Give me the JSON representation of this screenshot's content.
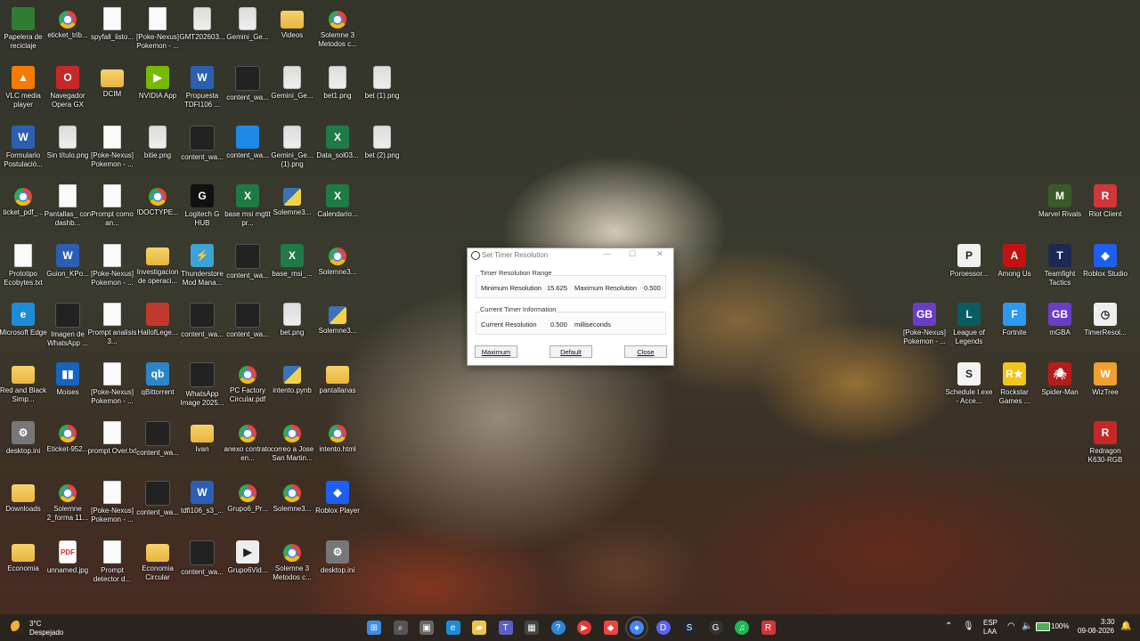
{
  "desktop": {
    "icons": [
      {
        "label": "Papelera de reciclaje",
        "type": "bin"
      },
      {
        "label": "eticket_trib...",
        "type": "chrome"
      },
      {
        "label": "spyfall_listo...",
        "type": "file"
      },
      {
        "label": "[Poke-Nexus] Pokemon - ...",
        "type": "file"
      },
      {
        "label": "GMT202603...",
        "type": "img"
      },
      {
        "label": "Gemini_Ge...",
        "type": "img"
      },
      {
        "label": "Videos",
        "type": "folder"
      },
      {
        "label": "Solemne 3 Metodos c...",
        "type": "chrome"
      },
      {
        "label": "VLC media player",
        "type": "vlc"
      },
      {
        "label": "Navegador Opera GX",
        "type": "opera"
      },
      {
        "label": "DCIM",
        "type": "folder"
      },
      {
        "label": "NVIDIA App",
        "type": "nvidia"
      },
      {
        "label": "Propuesta TDFI106 ...",
        "type": "word"
      },
      {
        "label": "content_wa...",
        "type": "dark"
      },
      {
        "label": "Gemini_Ge...",
        "type": "img"
      },
      {
        "label": "bet1.png",
        "type": "img"
      },
      {
        "label": "bet (1).png",
        "type": "img"
      },
      {
        "label": "Formulario Postulació...",
        "type": "word"
      },
      {
        "label": "Sin título.png",
        "type": "img"
      },
      {
        "label": "[Poke-Nexus] Pokemon - ...",
        "type": "file"
      },
      {
        "label": "bitie.png",
        "type": "img"
      },
      {
        "label": "content_wa...",
        "type": "dark"
      },
      {
        "label": "content_wa...",
        "type": "blue"
      },
      {
        "label": "Gemini_Ge... (1).png",
        "type": "img"
      },
      {
        "label": "Data_sol03...",
        "type": "excel"
      },
      {
        "label": "bet (2).png",
        "type": "img"
      },
      {
        "label": "ticket_pdf_...",
        "type": "chrome"
      },
      {
        "label": "Pantallas_ con dashb...",
        "type": "file"
      },
      {
        "label": "Prompt como an...",
        "type": "file"
      },
      {
        "label": "!DOCTYPE...",
        "type": "chrome"
      },
      {
        "label": "Logitech G HUB",
        "type": "logi"
      },
      {
        "label": "base msi mgtit pr...",
        "type": "excel"
      },
      {
        "label": "Solemne3...",
        "type": "py"
      },
      {
        "label": "Calendario...",
        "type": "excel"
      },
      {
        "label": "Prototipo Ecobytes.txt",
        "type": "file"
      },
      {
        "label": "Guion_KPo...",
        "type": "word"
      },
      {
        "label": "[Poke-Nexus] Pokemon - ...",
        "type": "file"
      },
      {
        "label": "Investigacion de operaci...",
        "type": "folder"
      },
      {
        "label": "Thunderstore Mod Mana...",
        "type": "thunder"
      },
      {
        "label": "content_wa...",
        "type": "dark"
      },
      {
        "label": "base_msi_...",
        "type": "excel"
      },
      {
        "label": "Solemne3...",
        "type": "chrome"
      },
      {
        "label": "Microsoft Edge",
        "type": "edge"
      },
      {
        "label": "Imagen de WhatsApp ...",
        "type": "dark"
      },
      {
        "label": "Prompt analisis 3...",
        "type": "file"
      },
      {
        "label": "HallofLege...",
        "type": "red"
      },
      {
        "label": "content_wa...",
        "type": "dark"
      },
      {
        "label": "content_wa...",
        "type": "dark"
      },
      {
        "label": "bet.png",
        "type": "img"
      },
      {
        "label": "Solemne3...",
        "type": "py"
      },
      {
        "label": "Red and Black Simp...",
        "type": "folder"
      },
      {
        "label": "Moises",
        "type": "moises"
      },
      {
        "label": "[Poke-Nexus] Pokemon - ...",
        "type": "file"
      },
      {
        "label": "qBittorrent",
        "type": "qbit"
      },
      {
        "label": "WhatsApp Image 2025...",
        "type": "dark"
      },
      {
        "label": "PC Factory Circular.pdf",
        "type": "chrome"
      },
      {
        "label": "intento.pynb",
        "type": "py"
      },
      {
        "label": "pantallanas",
        "type": "folder"
      },
      {
        "label": "desktop.ini",
        "type": "gear"
      },
      {
        "label": "Eticket-952...",
        "type": "chrome"
      },
      {
        "label": "prompt Over.txt",
        "type": "file"
      },
      {
        "label": "content_wa...",
        "type": "dark"
      },
      {
        "label": "Ivan",
        "type": "folder"
      },
      {
        "label": "anexo contrato en...",
        "type": "chrome"
      },
      {
        "label": "correo a Jose San Martin...",
        "type": "chrome"
      },
      {
        "label": "intento.html",
        "type": "chrome"
      },
      {
        "label": "Downloads",
        "type": "folder"
      },
      {
        "label": "Solemne 2_forma 11...",
        "type": "chrome"
      },
      {
        "label": "[Poke-Nexus] Pokemon - ...",
        "type": "file"
      },
      {
        "label": "content_wa...",
        "type": "dark"
      },
      {
        "label": "tdfi106_s3_...",
        "type": "word"
      },
      {
        "label": "Grupo6_Pr...",
        "type": "chrome"
      },
      {
        "label": "Solemne3...",
        "type": "chrome"
      },
      {
        "label": "Roblox Player",
        "type": "roblox"
      },
      {
        "label": "Economia",
        "type": "folder"
      },
      {
        "label": "unnamed.jpg",
        "type": "pdf"
      },
      {
        "label": "Prompt detector d...",
        "type": "file"
      },
      {
        "label": "Economia Circular",
        "type": "folder"
      },
      {
        "label": "content_wa...",
        "type": "dark"
      },
      {
        "label": "Grupo6Vid...",
        "type": "video"
      },
      {
        "label": "Solemne 3 Metodos c...",
        "type": "chrome"
      },
      {
        "label": "desktop.ini",
        "type": "gear"
      }
    ],
    "right_icons": [
      {
        "label": "Marvel Rivals",
        "type": "marvel"
      },
      {
        "label": "Riot Client",
        "type": "riot"
      },
      {
        "label": "Poroessor...",
        "type": "poro"
      },
      {
        "label": "Among Us",
        "type": "among"
      },
      {
        "label": "Teamfight Tactics",
        "type": "tft"
      },
      {
        "label": "Roblox Studio",
        "type": "roblox"
      },
      {
        "label": "[Poke-Nexus] Pokemon - ...",
        "type": "mgba"
      },
      {
        "label": "League of Legends",
        "type": "lol"
      },
      {
        "label": "Fortnite",
        "type": "fortnite"
      },
      {
        "label": "mGBA",
        "type": "mgba"
      },
      {
        "label": "TimerResol...",
        "type": "timer"
      },
      {
        "label": "Schedule I.exe - Acce...",
        "type": "sched"
      },
      {
        "label": "Rockstar Games ...",
        "type": "rockstar"
      },
      {
        "label": "Spider-Man",
        "type": "spider"
      },
      {
        "label": "WizTree",
        "type": "wiz"
      },
      {
        "label": "Redragon K630-RGB",
        "type": "redragon"
      }
    ]
  },
  "dialog": {
    "title": "Set Timer Resolution",
    "range_group": "Timer Resolution Range",
    "min_label": "Minimum Resolution",
    "min_value": "15.625",
    "max_label": "Maximum Resolution",
    "max_value": "0.500",
    "current_group": "Current Timer Information",
    "current_label": "Current Resolution",
    "current_value": "0.500",
    "current_unit": "milliseconds",
    "btn_maximum": "Maximum",
    "btn_default": "Default",
    "btn_close": "Close",
    "win_minimize": "—",
    "win_maximize": "☐",
    "win_close": "✕"
  },
  "taskbar": {
    "weather_temp": "3°C",
    "weather_desc": "Despejado",
    "lang_top": "ESP",
    "lang_bottom": "LAA",
    "battery": "100%",
    "time": "3:30",
    "date": "09-08-2026",
    "apps": [
      "start",
      "search",
      "task-view",
      "edge",
      "file-explorer",
      "teams",
      "store",
      "help",
      "youtube-music",
      "anydesk",
      "chrome",
      "discord",
      "steam",
      "github",
      "spotify",
      "riot-client"
    ]
  },
  "colors": {
    "taskbar_bg": "#28241e",
    "dialog_bg": "#ffffff",
    "accent": "#2b5fb4"
  }
}
